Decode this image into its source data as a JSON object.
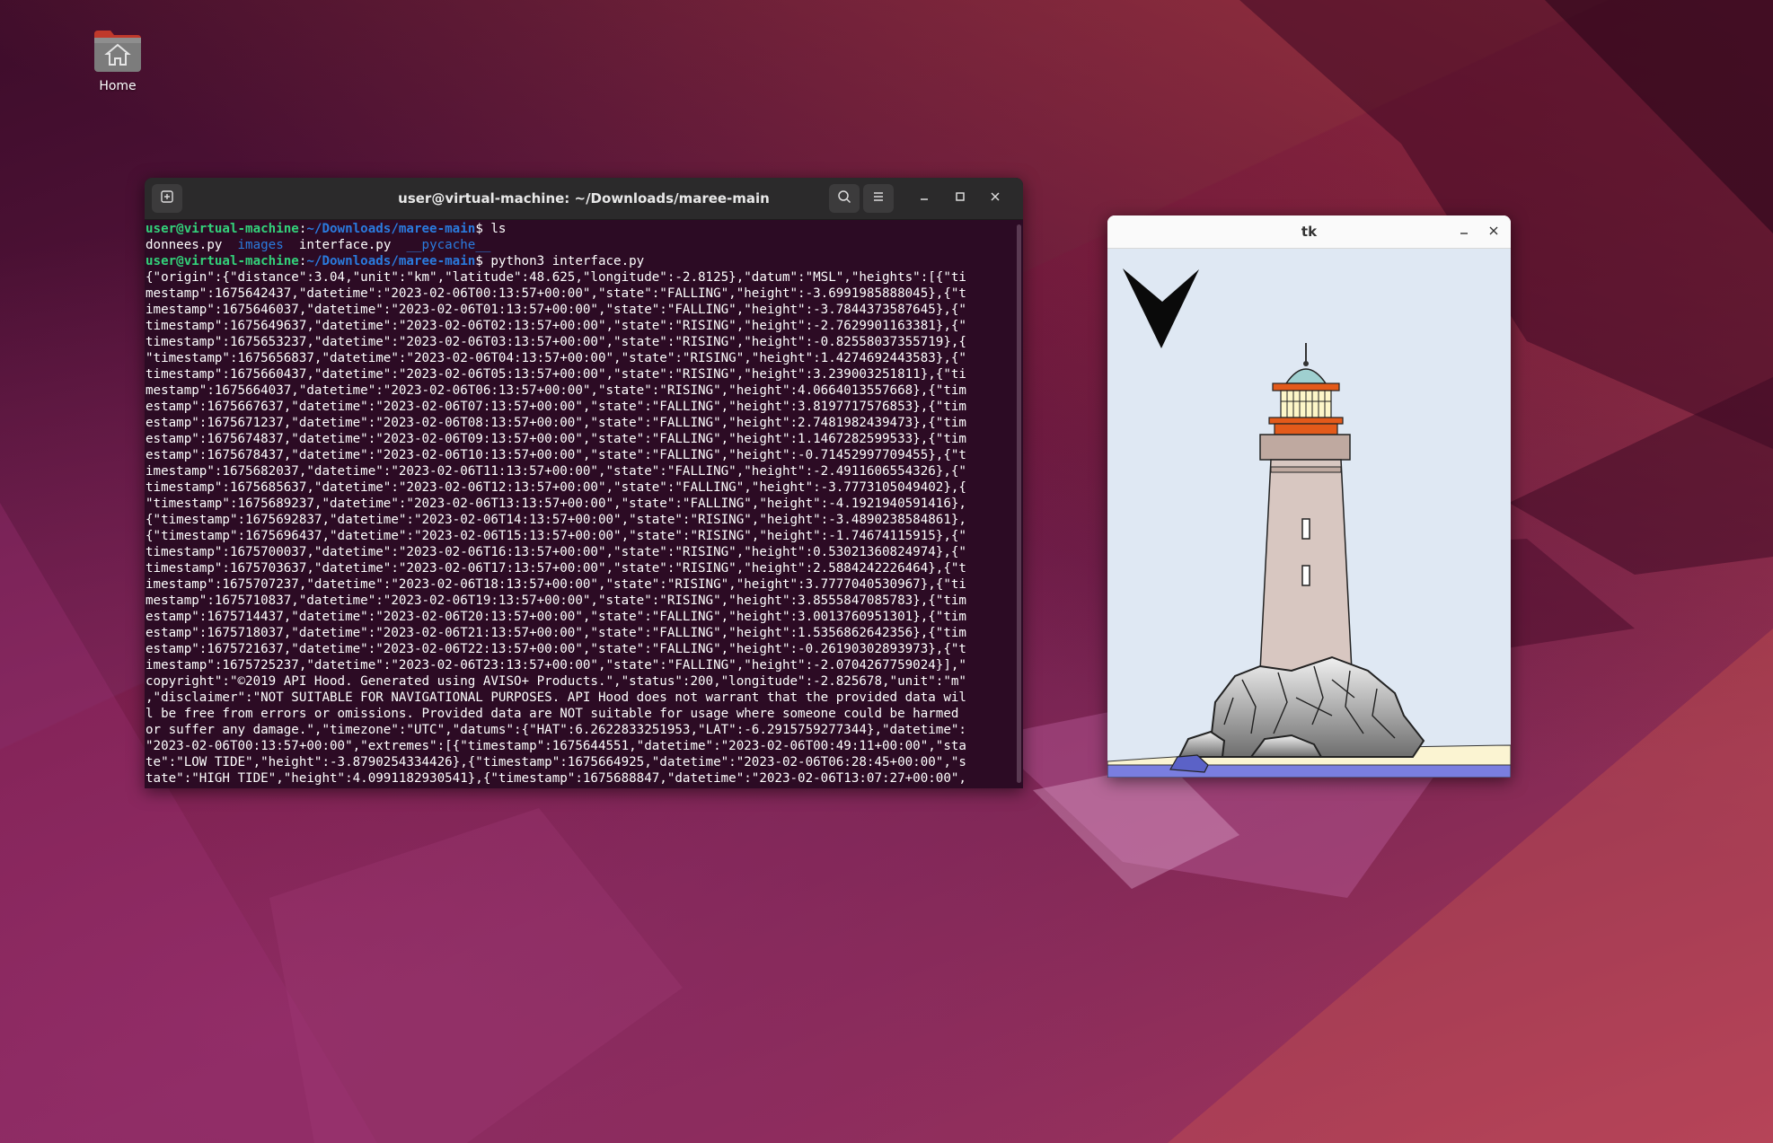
{
  "desktop": {
    "home_label": "Home"
  },
  "terminal": {
    "title": "user@virtual-machine: ~/Downloads/maree-main",
    "prompt_user": "user@virtual-machine",
    "prompt_path": "~/Downloads/maree-main",
    "cmd1": "$ ls",
    "ls_files": [
      "donnees.py",
      "images",
      "interface.py",
      "__pycache__"
    ],
    "cmd2": "$ python3 interface.py",
    "output_lines": [
      "{\"origin\":{\"distance\":3.04,\"unit\":\"km\",\"latitude\":48.625,\"longitude\":-2.8125},\"datum\":\"MSL\",\"heights\":[{\"ti",
      "mestamp\":1675642437,\"datetime\":\"2023-02-06T00:13:57+00:00\",\"state\":\"FALLING\",\"height\":-3.6991985888045},{\"t",
      "imestamp\":1675646037,\"datetime\":\"2023-02-06T01:13:57+00:00\",\"state\":\"FALLING\",\"height\":-3.7844373587645},{\"",
      "timestamp\":1675649637,\"datetime\":\"2023-02-06T02:13:57+00:00\",\"state\":\"RISING\",\"height\":-2.7629901163381},{\"",
      "timestamp\":1675653237,\"datetime\":\"2023-02-06T03:13:57+00:00\",\"state\":\"RISING\",\"height\":-0.82558037355719},{",
      "\"timestamp\":1675656837,\"datetime\":\"2023-02-06T04:13:57+00:00\",\"state\":\"RISING\",\"height\":1.4274692443583},{\"",
      "timestamp\":1675660437,\"datetime\":\"2023-02-06T05:13:57+00:00\",\"state\":\"RISING\",\"height\":3.239003251811},{\"ti",
      "mestamp\":1675664037,\"datetime\":\"2023-02-06T06:13:57+00:00\",\"state\":\"RISING\",\"height\":4.0664013557668},{\"tim",
      "estamp\":1675667637,\"datetime\":\"2023-02-06T07:13:57+00:00\",\"state\":\"FALLING\",\"height\":3.8197717576853},{\"tim",
      "estamp\":1675671237,\"datetime\":\"2023-02-06T08:13:57+00:00\",\"state\":\"FALLING\",\"height\":2.7481982439473},{\"tim",
      "estamp\":1675674837,\"datetime\":\"2023-02-06T09:13:57+00:00\",\"state\":\"FALLING\",\"height\":1.1467282599533},{\"tim",
      "estamp\":1675678437,\"datetime\":\"2023-02-06T10:13:57+00:00\",\"state\":\"FALLING\",\"height\":-0.71452997709455},{\"t",
      "imestamp\":1675682037,\"datetime\":\"2023-02-06T11:13:57+00:00\",\"state\":\"FALLING\",\"height\":-2.4911606554326},{\"",
      "timestamp\":1675685637,\"datetime\":\"2023-02-06T12:13:57+00:00\",\"state\":\"FALLING\",\"height\":-3.7773105049402},{",
      "\"timestamp\":1675689237,\"datetime\":\"2023-02-06T13:13:57+00:00\",\"state\":\"FALLING\",\"height\":-4.1921940591416},",
      "{\"timestamp\":1675692837,\"datetime\":\"2023-02-06T14:13:57+00:00\",\"state\":\"RISING\",\"height\":-3.4890238584861},",
      "{\"timestamp\":1675696437,\"datetime\":\"2023-02-06T15:13:57+00:00\",\"state\":\"RISING\",\"height\":-1.74674115915},{\"",
      "timestamp\":1675700037,\"datetime\":\"2023-02-06T16:13:57+00:00\",\"state\":\"RISING\",\"height\":0.53021360824974},{\"",
      "timestamp\":1675703637,\"datetime\":\"2023-02-06T17:13:57+00:00\",\"state\":\"RISING\",\"height\":2.5884242226464},{\"t",
      "imestamp\":1675707237,\"datetime\":\"2023-02-06T18:13:57+00:00\",\"state\":\"RISING\",\"height\":3.7777040530967},{\"ti",
      "mestamp\":1675710837,\"datetime\":\"2023-02-06T19:13:57+00:00\",\"state\":\"RISING\",\"height\":3.8555847085783},{\"tim",
      "estamp\":1675714437,\"datetime\":\"2023-02-06T20:13:57+00:00\",\"state\":\"FALLING\",\"height\":3.0013760951301},{\"tim",
      "estamp\":1675718037,\"datetime\":\"2023-02-06T21:13:57+00:00\",\"state\":\"FALLING\",\"height\":1.5356862642356},{\"tim",
      "estamp\":1675721637,\"datetime\":\"2023-02-06T22:13:57+00:00\",\"state\":\"FALLING\",\"height\":-0.26190302893973},{\"t",
      "imestamp\":1675725237,\"datetime\":\"2023-02-06T23:13:57+00:00\",\"state\":\"FALLING\",\"height\":-2.0704267759024}],\"",
      "copyright\":\"©2019 API Hood. Generated using AVISO+ Products.\",\"status\":200,\"longitude\":-2.825678,\"unit\":\"m\"",
      ",\"disclaimer\":\"NOT SUITABLE FOR NAVIGATIONAL PURPOSES. API Hood does not warrant that the provided data wil",
      "l be free from errors or omissions. Provided data are NOT suitable for usage where someone could be harmed",
      "or suffer any damage.\",\"timezone\":\"UTC\",\"datums\":{\"HAT\":6.2622833251953,\"LAT\":-6.2915759277344},\"datetime\":",
      "\"2023-02-06T00:13:57+00:00\",\"extremes\":[{\"timestamp\":1675644551,\"datetime\":\"2023-02-06T00:49:11+00:00\",\"sta",
      "te\":\"LOW TIDE\",\"height\":-3.8790254334426},{\"timestamp\":1675664925,\"datetime\":\"2023-02-06T06:28:45+00:00\",\"s",
      "tate\":\"HIGH TIDE\",\"height\":4.0991182930541},{\"timestamp\":1675688847,\"datetime\":\"2023-02-06T13:07:27+00:00\","
    ]
  },
  "tk_window": {
    "title": "tk"
  },
  "icons": {
    "new_tab": "new-tab-icon",
    "search": "search-icon",
    "menu": "hamburger-menu-icon",
    "minimize": "minimize-icon",
    "maximize": "maximize-icon",
    "close": "close-icon",
    "home_folder": "home-folder-icon",
    "direction_arrow": "arrowhead-down-icon"
  },
  "colors": {
    "terminal_bg": "#2c0b24",
    "prompt_user": "#33d17a",
    "prompt_path": "#2a7bde",
    "lighthouse_lamp": "#e35a1a",
    "sea": "#7a7ee0",
    "sky": "#dfe8f3"
  }
}
